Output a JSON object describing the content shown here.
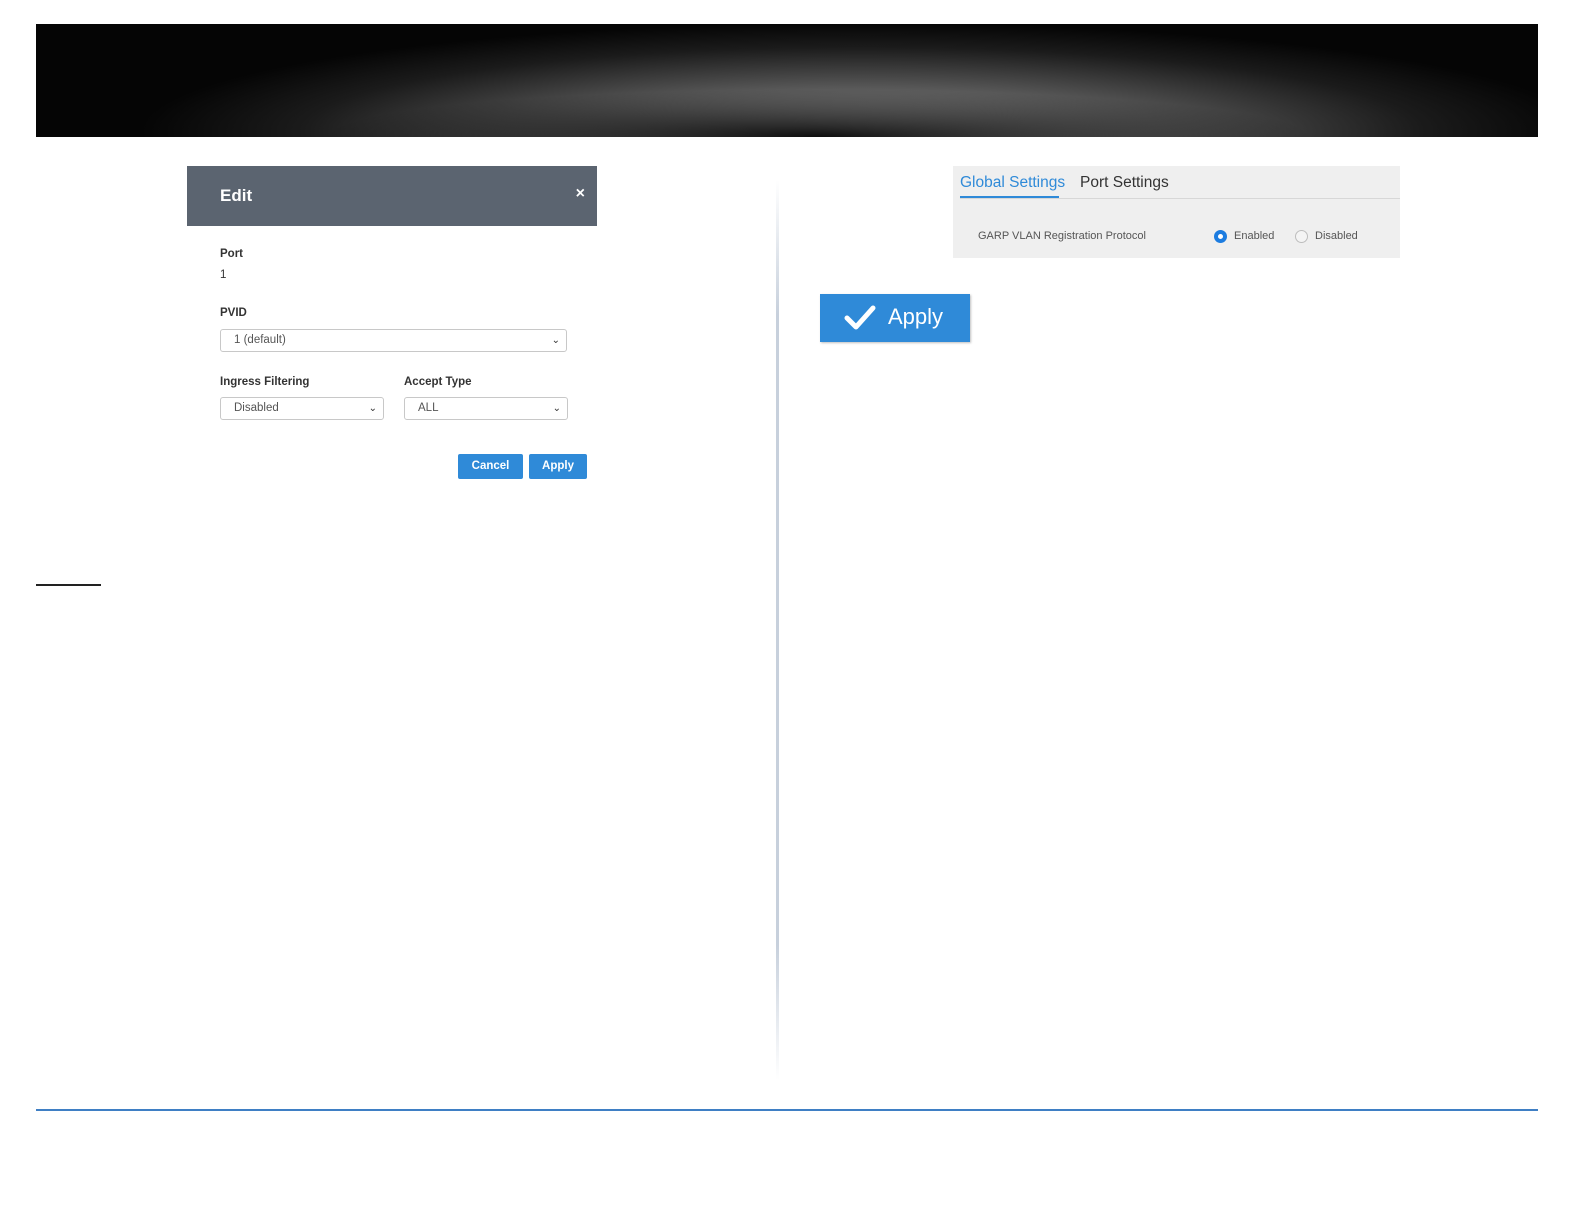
{
  "edit_dialog": {
    "title": "Edit",
    "close_icon": "×",
    "port_label": "Port",
    "port_value": "1",
    "pvid_label": "PVID",
    "pvid_value": "1 (default)",
    "ingress_label": "Ingress Filtering",
    "ingress_value": "Disabled",
    "accept_label": "Accept Type",
    "accept_value": "ALL",
    "cancel_label": "Cancel",
    "apply_label": "Apply"
  },
  "settings_panel": {
    "tabs": [
      {
        "label": "Global Settings",
        "active": true
      },
      {
        "label": "Port Settings",
        "active": false
      }
    ],
    "setting_label": "GARP VLAN Registration Protocol",
    "options": [
      {
        "label": "Enabled",
        "selected": true
      },
      {
        "label": "Disabled",
        "selected": false
      }
    ]
  },
  "apply_button": {
    "label": "Apply",
    "icon": "check-icon"
  },
  "colors": {
    "accent": "#2f8ad8",
    "dialog_header": "#5b6470",
    "footer_rule": "#3f7fc4"
  }
}
